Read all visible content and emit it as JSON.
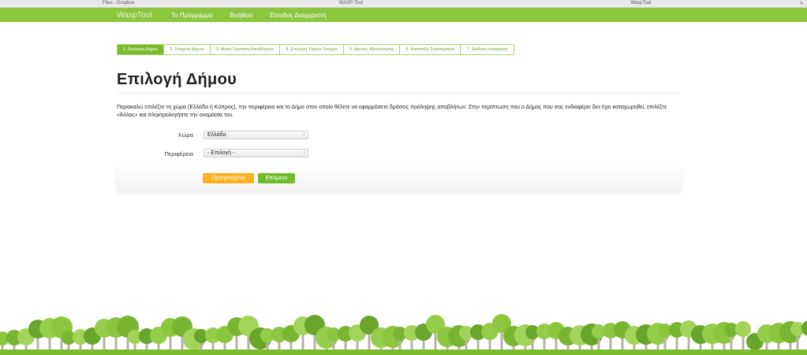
{
  "browser_tabs": [
    "Files - Dropbox",
    "WASP-Tool",
    "WaspTool"
  ],
  "nav": {
    "brand": "WaspTool",
    "items": [
      "Το Πρόγραμμα",
      "Βοήθεια",
      "Είσοδος Διαχειριστή"
    ]
  },
  "steps": [
    "1. Επιλογή Δήμου",
    "2. Στοιχεία Δήμου",
    "3. Μέση Σύσταση Αποβλήτων",
    "4. Επιλογή Υλικών Στόχων",
    "5. Δείκτες Αξιολόγησης",
    "6. Κατάταξη Στρατηγικών",
    "7. Έκδοση αναφοράς"
  ],
  "page": {
    "title": "Επιλογή Δήμου",
    "intro": "Παρακαλώ επιλέξτε τη χώρα (Ελλάδα ή Κύπρος), την περιφέρεια και το Δήμο στον οποίο θέλετε να εφαρμόσετε δράσεις πρόληψης αποβλήτων. Στην περίπτωση που ο Δήμος που σας ενδιαφέρει δεν έχει καταχωρηθεί, επιλέξτε «Άλλος» και πληκτρολογήστε την ονομασία του."
  },
  "form": {
    "country_label": "Χώρα",
    "country_value": "Ελλάδα",
    "region_label": "Περιφέρεια",
    "region_value": "- Επιλογή -"
  },
  "buttons": {
    "prev": "Προηγούμενο",
    "next": "Επόμενο"
  },
  "colors": {
    "nav_green": "#8cc63f",
    "step_active": "#7dbb2e",
    "prev_button": "#f5b324",
    "next_button": "#6ebd2c"
  }
}
